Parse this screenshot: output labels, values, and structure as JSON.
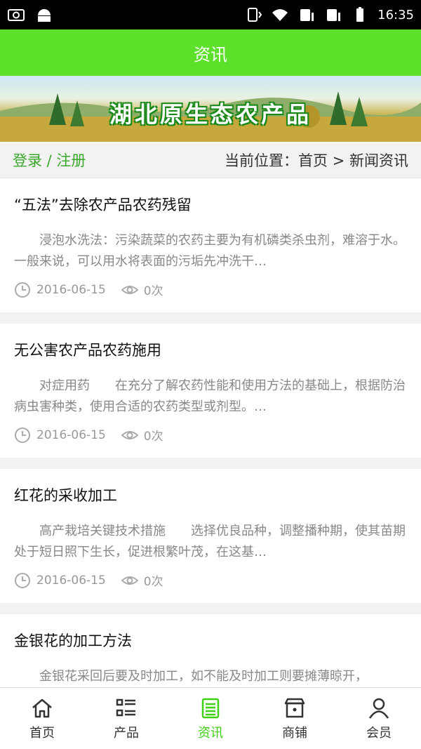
{
  "status": {
    "time": "16:35"
  },
  "header": {
    "title": "资讯"
  },
  "banner": {
    "title": "湖北原生态农产品"
  },
  "crumb": {
    "login": "登录 / 注册",
    "location": "当前位置：首页 > 新闻资讯"
  },
  "articles": [
    {
      "title": "“五法”去除农产品农药残留",
      "excerpt": "浸泡水洗法：污染蔬菜的农药主要为有机磷类杀虫剂，难溶于水。一般来说，可以用水将表面的污垢先冲洗干…",
      "date": "2016-06-15",
      "views": "0次"
    },
    {
      "title": "无公害农产品农药施用",
      "excerpt": "对症用药　　在充分了解农药性能和使用方法的基础上，根据防治病虫害种类，使用合适的农药类型或剂型。…",
      "date": "2016-06-15",
      "views": "0次"
    },
    {
      "title": "红花的采收加工",
      "excerpt": "高产栽培关键技术措施　　选择优良品种，调整播种期，使其苗期处于短日照下生长，促进根繁叶茂，在这基…",
      "date": "2016-06-15",
      "views": "0次"
    },
    {
      "title": "金银花的加工方法",
      "excerpt": "金银花采回后要及时加工，如不能及时加工则要摊薄晾开，",
      "date": "",
      "views": ""
    }
  ],
  "tabs": [
    {
      "label": "首页",
      "icon": "home-icon"
    },
    {
      "label": "产品",
      "icon": "list-icon"
    },
    {
      "label": "资讯",
      "icon": "document-icon"
    },
    {
      "label": "商铺",
      "icon": "shop-icon"
    },
    {
      "label": "会员",
      "icon": "user-icon"
    }
  ],
  "colors": {
    "accent": "#5ce02a",
    "active_tab": "#3fd014",
    "login_link": "#3aa82c"
  }
}
